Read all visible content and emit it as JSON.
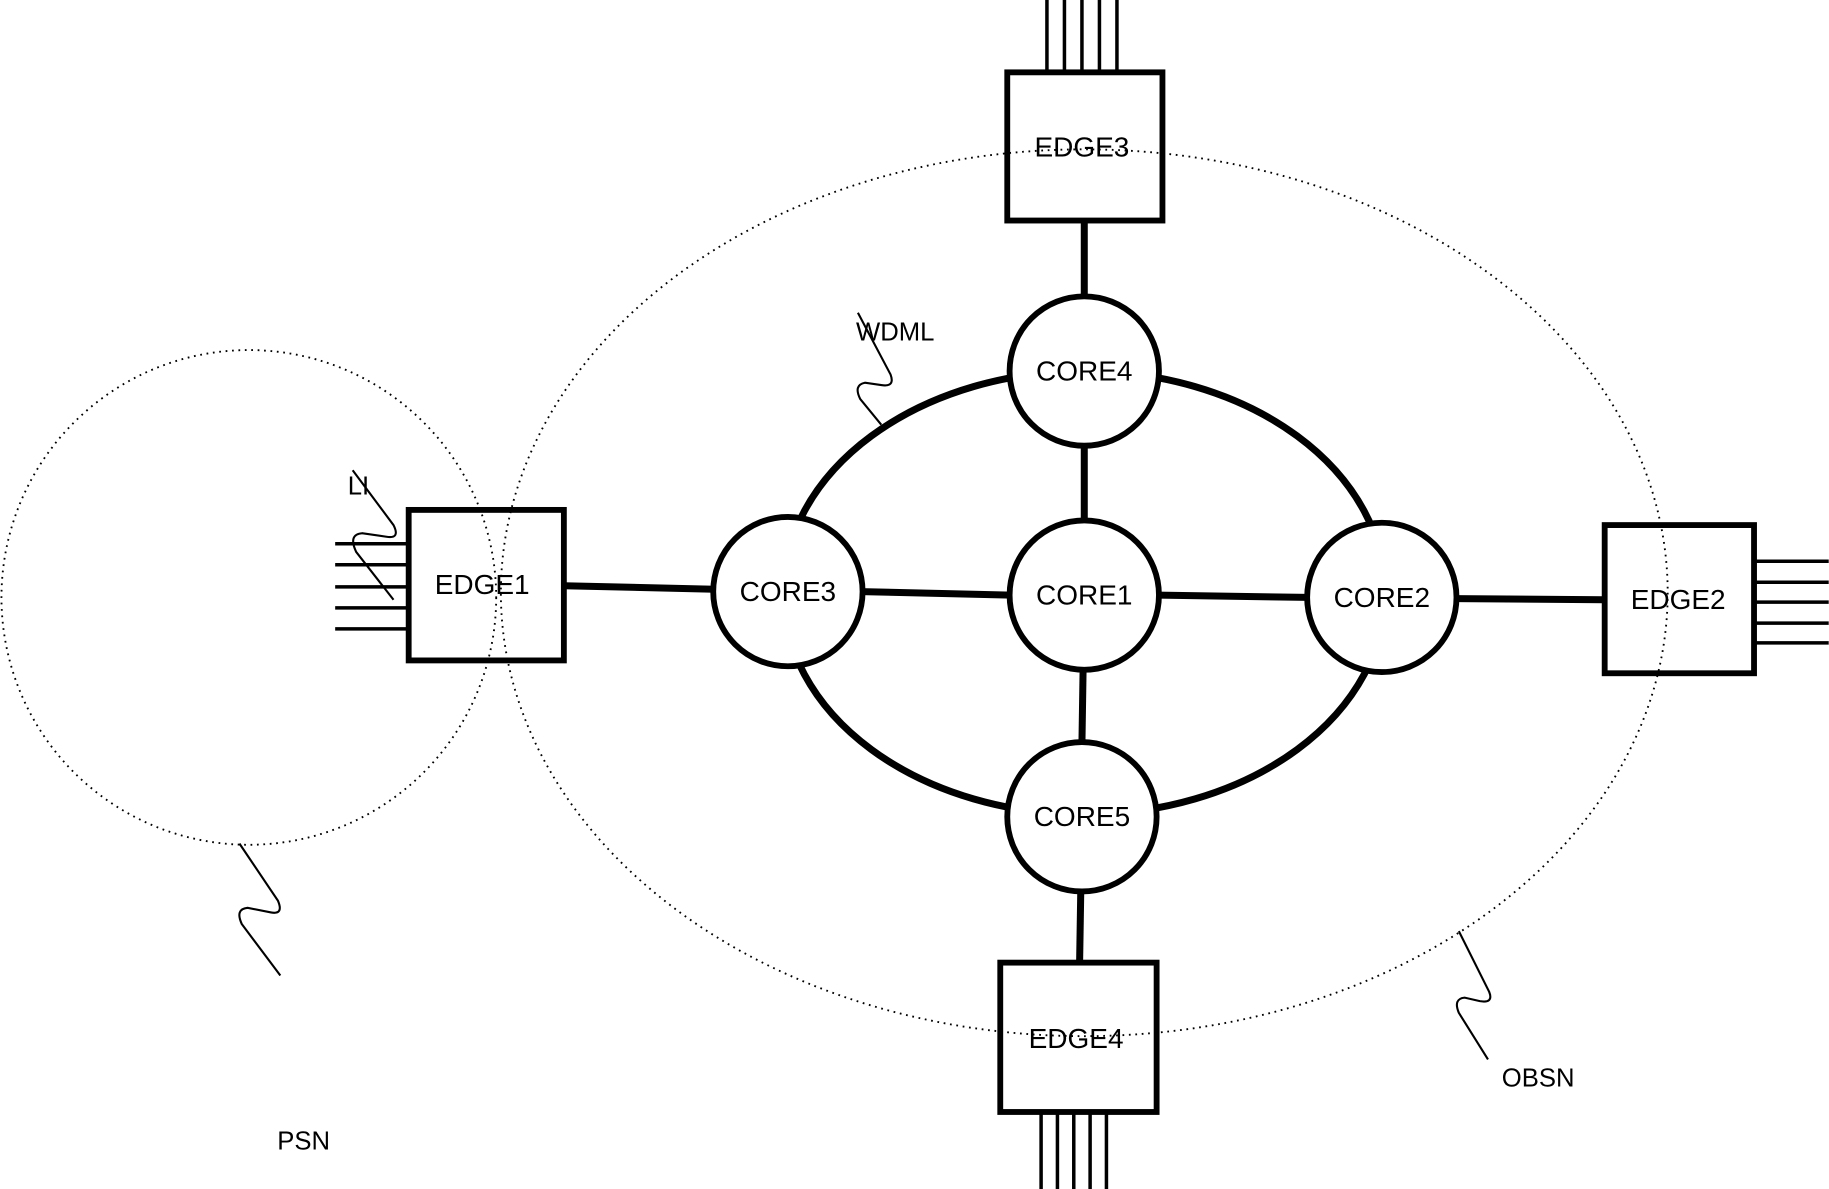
{
  "diagram": {
    "type": "network-topology",
    "colors": {
      "stroke": "#000000",
      "background": "#ffffff"
    },
    "regions": [
      {
        "id": "PSN",
        "label": "PSN",
        "style": "dotted",
        "shape": "circle"
      },
      {
        "id": "OBSN",
        "label": "OBSN",
        "style": "dotted",
        "shape": "ellipse"
      }
    ],
    "ring": {
      "id": "WDML",
      "label": "WDML"
    },
    "core_nodes": [
      {
        "id": "CORE1",
        "label": "CORE1"
      },
      {
        "id": "CORE2",
        "label": "CORE2"
      },
      {
        "id": "CORE3",
        "label": "CORE3"
      },
      {
        "id": "CORE4",
        "label": "CORE4"
      },
      {
        "id": "CORE5",
        "label": "CORE5"
      }
    ],
    "edge_nodes": [
      {
        "id": "EDGE1",
        "label": "EDGE1",
        "external_links": 5
      },
      {
        "id": "EDGE2",
        "label": "EDGE2",
        "external_links": 5
      },
      {
        "id": "EDGE3",
        "label": "EDGE3",
        "external_links": 5
      },
      {
        "id": "EDGE4",
        "label": "EDGE4",
        "external_links": 5
      }
    ],
    "links": [
      [
        "EDGE1",
        "CORE3"
      ],
      [
        "CORE3",
        "CORE1"
      ],
      [
        "CORE1",
        "CORE2"
      ],
      [
        "CORE2",
        "EDGE2"
      ],
      [
        "EDGE3",
        "CORE4"
      ],
      [
        "CORE4",
        "CORE1"
      ],
      [
        "CORE1",
        "CORE5"
      ],
      [
        "CORE5",
        "EDGE4"
      ],
      [
        "CORE3",
        "CORE4"
      ],
      [
        "CORE4",
        "CORE2"
      ],
      [
        "CORE2",
        "CORE5"
      ],
      [
        "CORE5",
        "CORE3"
      ]
    ],
    "callouts": [
      {
        "id": "LI",
        "label": "LI",
        "target": "EDGE1 input lines"
      },
      {
        "id": "WDML",
        "label": "WDML",
        "target": "core ring"
      },
      {
        "id": "PSN",
        "label": "PSN",
        "target": "PSN region"
      },
      {
        "id": "OBSN",
        "label": "OBSN",
        "target": "OBSN region"
      }
    ]
  }
}
